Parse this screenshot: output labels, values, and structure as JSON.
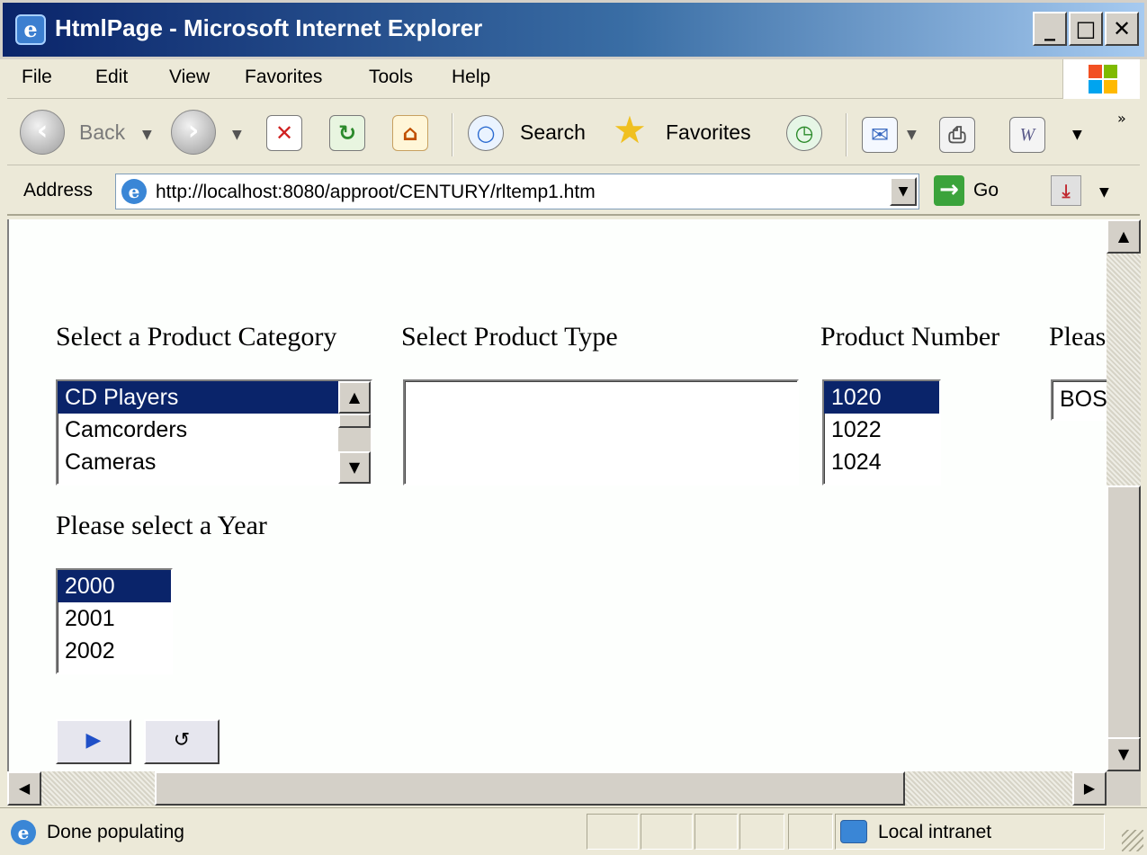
{
  "window": {
    "title": "HtmlPage - Microsoft Internet Explorer",
    "app_icon": "ie-icon",
    "controls": [
      "minimize",
      "maximize",
      "close"
    ]
  },
  "menubar": {
    "items": [
      "File",
      "Edit",
      "View",
      "Favorites",
      "Tools",
      "Help"
    ]
  },
  "toolbar": {
    "back_label": "Back",
    "search_label": "Search",
    "favorites_label": "Favorites",
    "icons": [
      "back-icon",
      "forward-icon",
      "stop-icon",
      "refresh-icon",
      "home-icon",
      "search-icon",
      "favorites-icon",
      "history-icon",
      "mail-icon",
      "print-icon",
      "edit-word-icon"
    ]
  },
  "addressbar": {
    "label": "Address",
    "url": "http://localhost:8080/approot/CENTURY/rltemp1.htm",
    "go_label": "Go"
  },
  "form": {
    "category": {
      "label": "Select a Product Category",
      "options": [
        "CD Players",
        "Camcorders",
        "Cameras"
      ],
      "selected_index": 0
    },
    "product_type": {
      "label": "Select Product Type",
      "options": []
    },
    "product_number": {
      "label": "Product Number",
      "options": [
        "1020",
        "1022",
        "1024"
      ],
      "selected_index": 0
    },
    "fourth": {
      "label": "Pleas",
      "value": "BOS"
    },
    "year": {
      "label": "Please select a Year",
      "options": [
        "2000",
        "2001",
        "2002"
      ],
      "selected_index": 0
    },
    "run_symbol": "▶",
    "reset_symbol": "↺"
  },
  "statusbar": {
    "text": "Done populating",
    "zone": "Local intranet"
  },
  "colors": {
    "selection": "#0a246a",
    "title_gradient_start": "#0a246a",
    "title_gradient_end": "#a6caf0",
    "chrome": "#ece9d8"
  }
}
